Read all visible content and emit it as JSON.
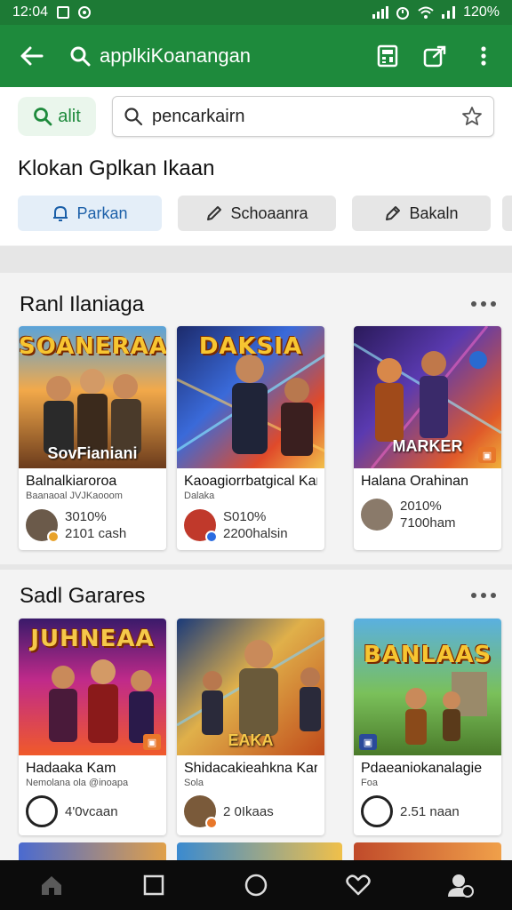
{
  "status_bar": {
    "time": "12:04",
    "battery": "120%"
  },
  "app_bar": {
    "title": "applkiKoanangan"
  },
  "search": {
    "filter_label": "alit",
    "placeholder": "pencarkairn"
  },
  "categories": {
    "title": "Klokan Gplkan Ikaan",
    "chips": [
      {
        "label": "Parkan",
        "icon": "bell-icon"
      },
      {
        "label": "Schoaanra",
        "icon": "pencil-icon"
      },
      {
        "label": "Bakaln",
        "icon": "pen-icon"
      }
    ]
  },
  "section1": {
    "title": "Ranl Ilaniaga",
    "cards": [
      {
        "art_title": "SOANERAAS",
        "art_sub": "SovFianiani",
        "name": "Balnalkiaroroa",
        "dev": "Baanaoal JVJKaooom",
        "pct": "3010%",
        "sub": "2101 cash"
      },
      {
        "art_title": "DAKSIA",
        "art_sub": "",
        "name": "Kaoagiorrbatgical Kar",
        "dev": "Dalaka",
        "pct": "S010%",
        "sub": "2200halsin"
      },
      {
        "art_title": "",
        "art_sub": "MARKER",
        "name": "Halana Orahinan",
        "dev": "",
        "pct": "2010%",
        "sub": "7100ham"
      }
    ]
  },
  "section2": {
    "title": "Sadl Garares",
    "cards": [
      {
        "art_title": "JUHNEAA",
        "art_sub": "",
        "name": "Hadaaka Kam",
        "dev": "Nemolana ola @inoapa",
        "sub": "4'0vcaan"
      },
      {
        "art_title": "",
        "art_sub": "EAKA",
        "name": "Shidacakieahkna Kar",
        "dev": "Sola",
        "sub": "2 0Ikaas"
      },
      {
        "art_title": "BANLAAS",
        "art_sub": "",
        "name": "Pdaeaniokanalagie",
        "dev": "Foa",
        "sub": "2.51 naan"
      }
    ]
  },
  "bottom_nav": [
    "home-icon",
    "square-icon",
    "circle-icon",
    "heart-icon",
    "profile-icon"
  ]
}
